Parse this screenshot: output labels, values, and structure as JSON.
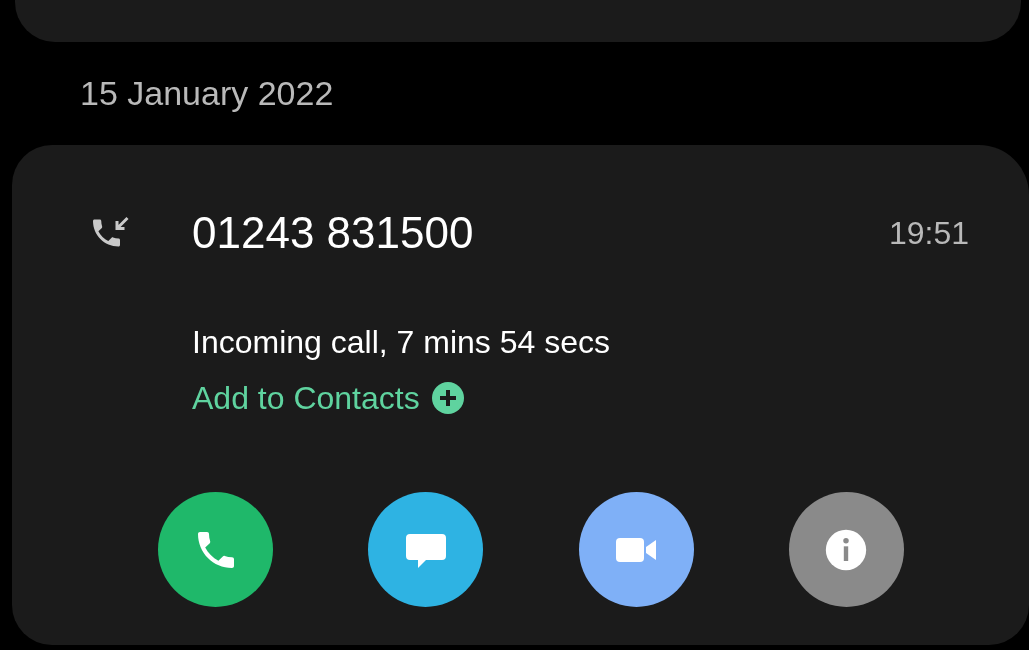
{
  "date_header": "15 January 2022",
  "call": {
    "incoming": true,
    "number": "01243 831500",
    "time": "19:51",
    "description": "Incoming call, 7 mins 54 secs",
    "add_to_contacts": "Add to Contacts"
  },
  "actions": [
    {
      "kind": "call",
      "color": "#1fb86a"
    },
    {
      "kind": "message",
      "color": "#2eb3e3"
    },
    {
      "kind": "video",
      "color": "#7fb0f7"
    },
    {
      "kind": "info",
      "color": "#8a8a8a"
    }
  ]
}
